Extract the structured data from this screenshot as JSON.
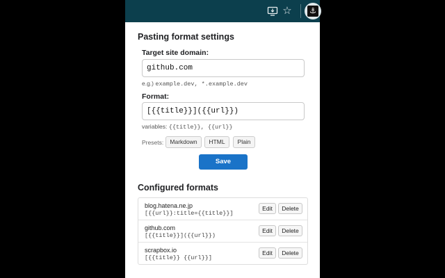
{
  "toolbar": {
    "icons": [
      "monitor-download-icon",
      "star-icon",
      "extension-icon"
    ],
    "extension_glyph": "⚓"
  },
  "settings": {
    "title": "Pasting format settings",
    "domain_label": "Target site domain:",
    "domain_value": "github.com",
    "domain_hint_prefix": "e.g.) ",
    "domain_hint_examples": "example.dev, *.example.dev",
    "format_label": "Format:",
    "format_value": "[{{title}}]({{url}})",
    "format_hint_prefix": "variables: ",
    "format_hint_vars": "{{title}}, {{url}}",
    "presets_label": "Presets:",
    "presets": [
      "Markdown",
      "HTML",
      "Plain"
    ],
    "save_label": "Save"
  },
  "configured": {
    "title": "Configured formats",
    "edit_label": "Edit",
    "delete_label": "Delete",
    "items": [
      {
        "domain": "blog.hatena.ne.jp",
        "format": "[{{url}}:title={{title}}]"
      },
      {
        "domain": "github.com",
        "format": "[{{title}}]({{url}})"
      },
      {
        "domain": "scrapbox.io",
        "format": "[{{title}} {{url}}]"
      }
    ]
  },
  "colors": {
    "toolbar_bg": "#0c3f4d",
    "save_button": "#1a73c8",
    "page_bg": "#000000"
  }
}
